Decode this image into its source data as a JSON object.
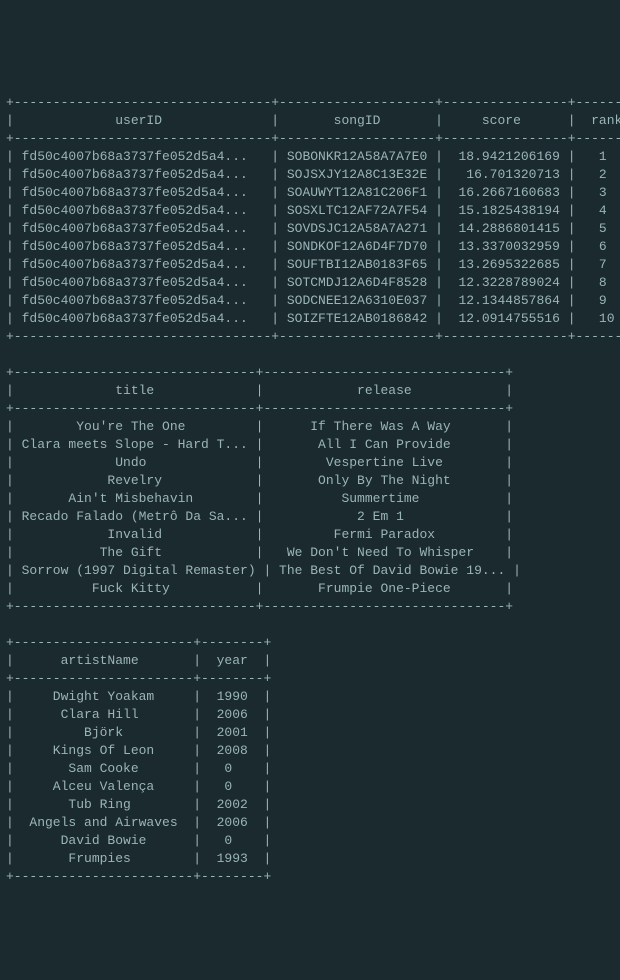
{
  "table1": {
    "columns": [
      "userID",
      "songID",
      "score",
      "rank"
    ],
    "widths": [
      31,
      18,
      14,
      6
    ],
    "rows": [
      [
        "fd50c4007b68a3737fe052d5a4...",
        "SOBONKR12A58A7A7E0",
        "18.9421206169",
        "1"
      ],
      [
        "fd50c4007b68a3737fe052d5a4...",
        "SOJSXJY12A8C13E32E",
        " 16.701320713",
        "2"
      ],
      [
        "fd50c4007b68a3737fe052d5a4...",
        "SOAUWYT12A81C206F1",
        "16.2667160683",
        "3"
      ],
      [
        "fd50c4007b68a3737fe052d5a4...",
        "SOSXLTC12AF72A7F54",
        "15.1825438194",
        "4"
      ],
      [
        "fd50c4007b68a3737fe052d5a4...",
        "SOVDSJC12A58A7A271",
        "14.2886801415",
        "5"
      ],
      [
        "fd50c4007b68a3737fe052d5a4...",
        "SONDKOF12A6D4F7D70",
        "13.3370032959",
        "6"
      ],
      [
        "fd50c4007b68a3737fe052d5a4...",
        "SOUFTBI12AB0183F65",
        "13.2695322685",
        "7"
      ],
      [
        "fd50c4007b68a3737fe052d5a4...",
        "SOTCMDJ12A6D4F8528",
        "12.3228789024",
        "8"
      ],
      [
        "fd50c4007b68a3737fe052d5a4...",
        "SODCNEE12A6310E037",
        "12.1344857864",
        "9"
      ],
      [
        "fd50c4007b68a3737fe052d5a4...",
        "SOIZFTE12AB0186842",
        "12.0914755516",
        "10"
      ]
    ]
  },
  "table2": {
    "columns": [
      "title",
      "release"
    ],
    "widths": [
      29,
      29
    ],
    "rows": [
      [
        "You're The One",
        "If There Was A Way"
      ],
      [
        "Clara meets Slope - Hard T...",
        "All I Can Provide"
      ],
      [
        "Undo",
        "Vespertine Live"
      ],
      [
        "Revelry",
        "Only By The Night"
      ],
      [
        "Ain't Misbehavin",
        "Summertime"
      ],
      [
        "Recado Falado (Metrô Da Sa...",
        "2 Em 1"
      ],
      [
        "Invalid",
        "Fermi Paradox"
      ],
      [
        "The Gift",
        "We Don't Need To Whisper"
      ],
      [
        "Sorrow (1997 Digital Remaster)",
        "The Best Of David Bowie 19..."
      ],
      [
        "Fuck Kitty",
        "Frumpie One-Piece"
      ]
    ]
  },
  "table3": {
    "columns": [
      "artistName",
      "year"
    ],
    "widths": [
      21,
      6
    ],
    "rows": [
      [
        "Dwight Yoakam",
        "1990"
      ],
      [
        "Clara Hill",
        "2006"
      ],
      [
        "Björk",
        "2001"
      ],
      [
        "Kings Of Leon",
        "2008"
      ],
      [
        "Sam Cooke",
        "0"
      ],
      [
        "Alceu Valença",
        "0"
      ],
      [
        "Tub Ring",
        "2002"
      ],
      [
        "Angels and Airwaves",
        "2006"
      ],
      [
        "David Bowie",
        "0"
      ],
      [
        "Frumpies",
        "1993"
      ]
    ]
  }
}
